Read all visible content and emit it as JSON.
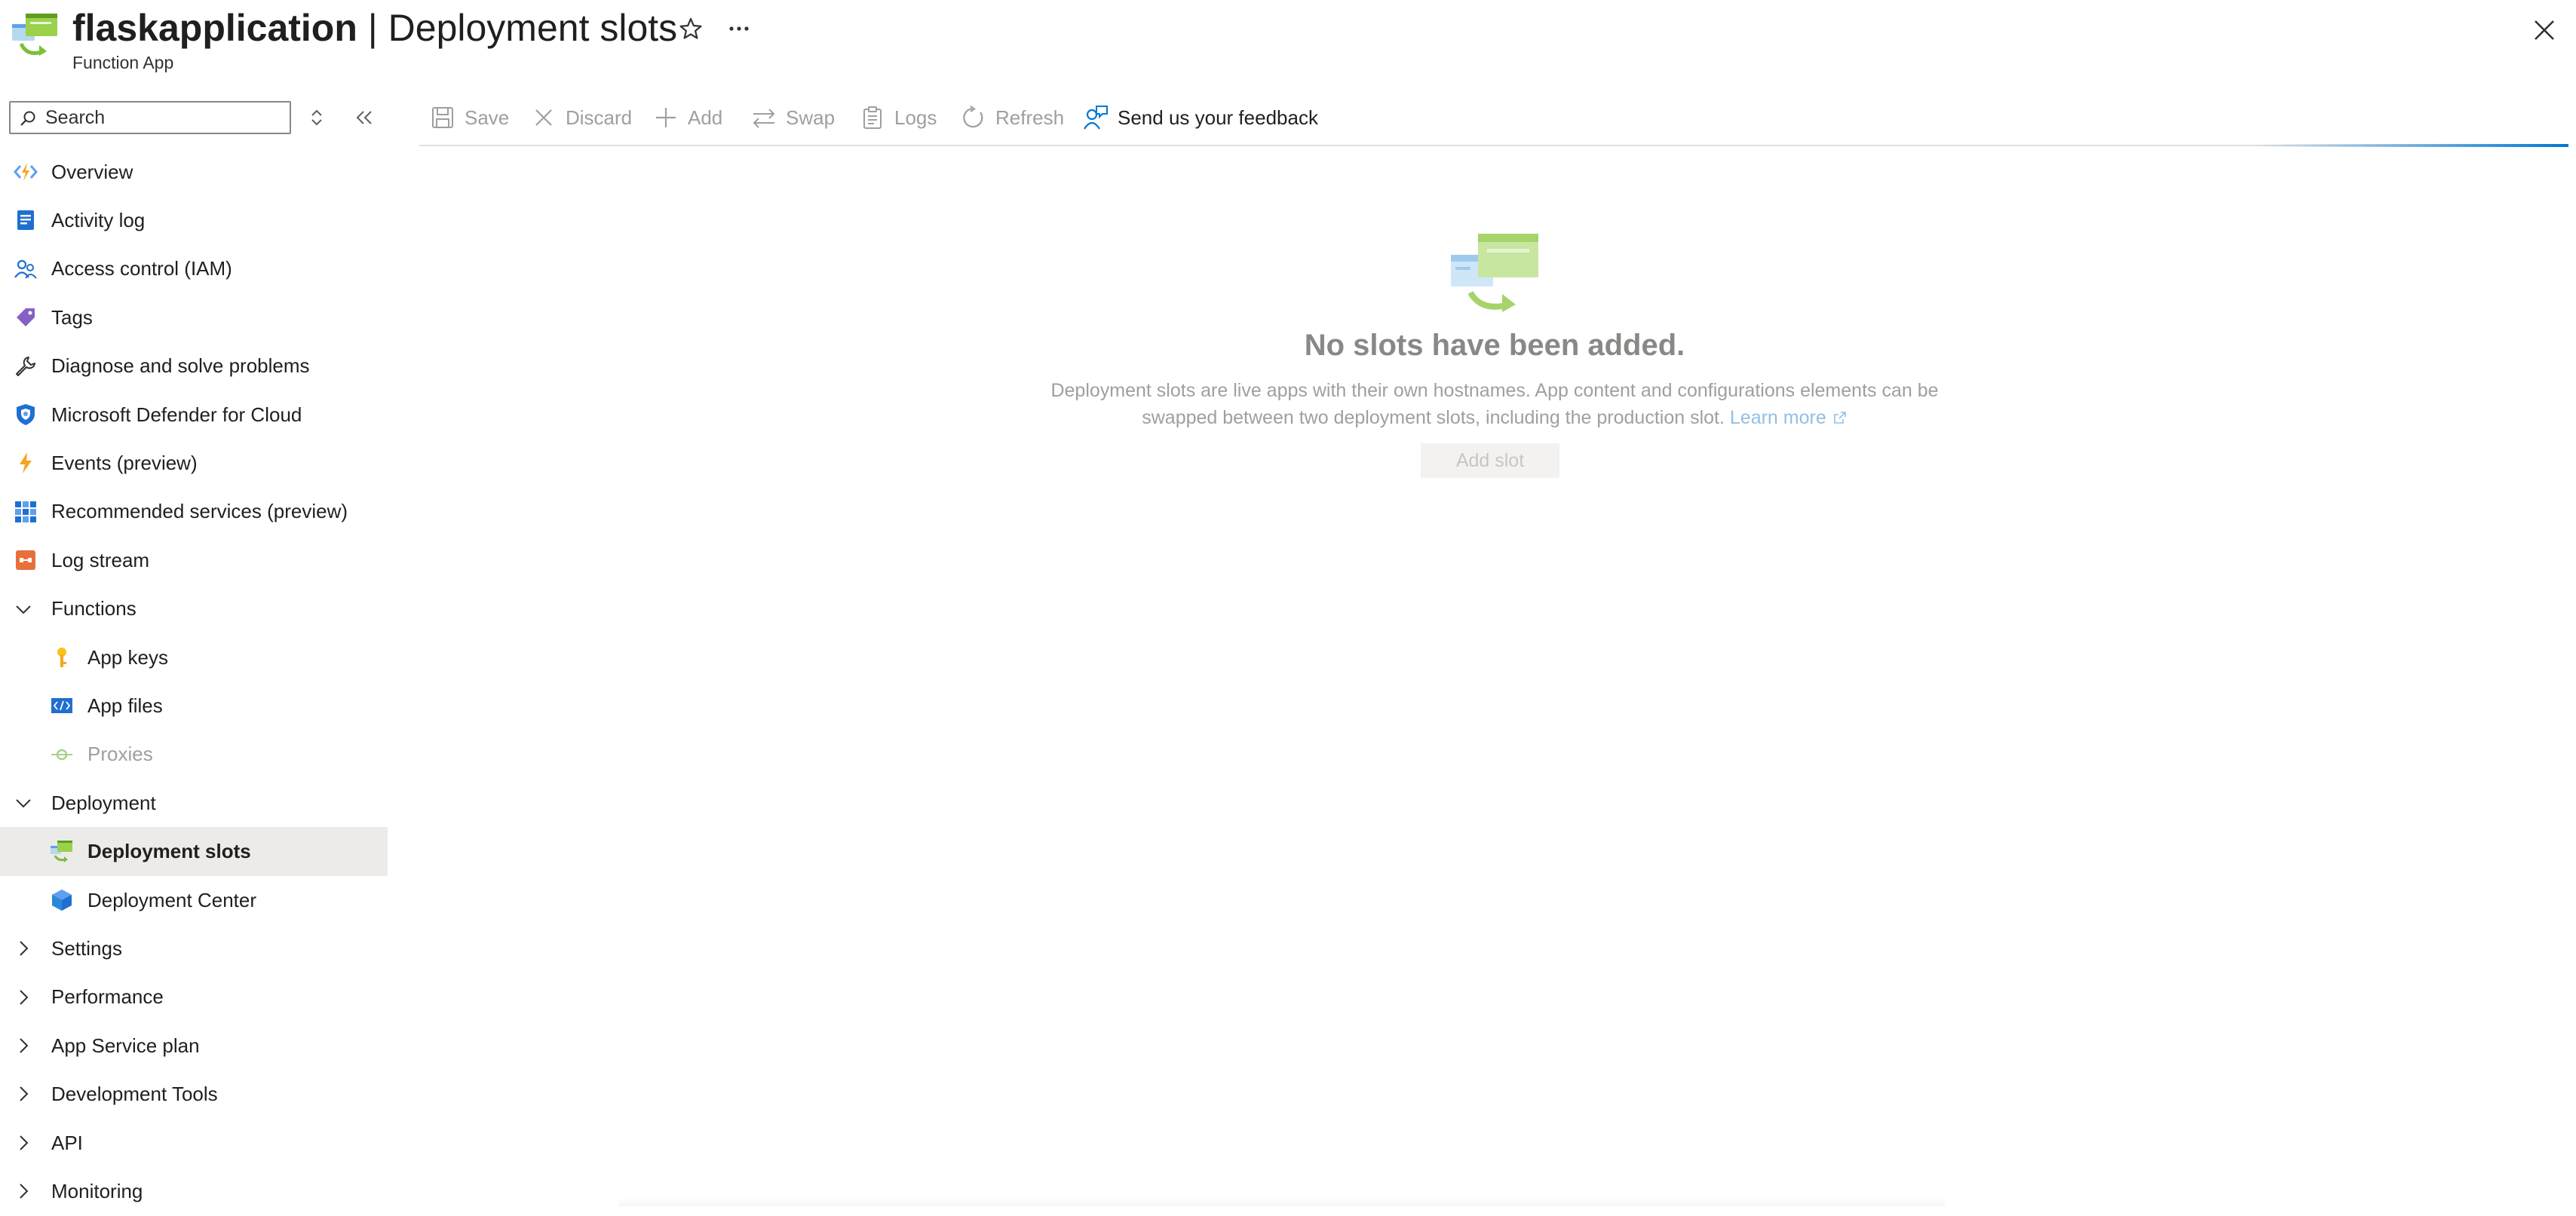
{
  "header": {
    "resource_name": "flaskapplication",
    "separator": " | ",
    "page_title": "Deployment slots",
    "subtitle": "Function App"
  },
  "sidebar": {
    "search_placeholder": "Search",
    "items": [
      {
        "label": "Overview",
        "icon": "function-app-icon"
      },
      {
        "label": "Activity log",
        "icon": "activity-log-icon"
      },
      {
        "label": "Access control (IAM)",
        "icon": "iam-people-icon"
      },
      {
        "label": "Tags",
        "icon": "tag-icon"
      },
      {
        "label": "Diagnose and solve problems",
        "icon": "wrench-icon"
      },
      {
        "label": "Microsoft Defender for Cloud",
        "icon": "shield-icon"
      },
      {
        "label": "Events (preview)",
        "icon": "lightning-icon"
      },
      {
        "label": "Recommended services (preview)",
        "icon": "grid-icon"
      },
      {
        "label": "Log stream",
        "icon": "log-stream-icon"
      },
      {
        "label": "Functions",
        "group": true,
        "expanded": true
      },
      {
        "label": "App keys",
        "icon": "key-icon",
        "child": true
      },
      {
        "label": "App files",
        "icon": "code-file-icon",
        "child": true
      },
      {
        "label": "Proxies",
        "icon": "proxy-icon",
        "child": true,
        "disabled": true
      },
      {
        "label": "Deployment",
        "group": true,
        "expanded": true
      },
      {
        "label": "Deployment slots",
        "icon": "deployment-slots-icon",
        "child": true,
        "selected": true
      },
      {
        "label": "Deployment Center",
        "icon": "cube-icon",
        "child": true
      },
      {
        "label": "Settings",
        "group": true,
        "expanded": false
      },
      {
        "label": "Performance",
        "group": true,
        "expanded": false
      },
      {
        "label": "App Service plan",
        "group": true,
        "expanded": false
      },
      {
        "label": "Development Tools",
        "group": true,
        "expanded": false
      },
      {
        "label": "API",
        "group": true,
        "expanded": false
      },
      {
        "label": "Monitoring",
        "group": true,
        "expanded": false
      }
    ]
  },
  "toolbar": {
    "save": "Save",
    "discard": "Discard",
    "add": "Add",
    "swap": "Swap",
    "logs": "Logs",
    "refresh": "Refresh",
    "feedback": "Send us your feedback"
  },
  "main": {
    "empty_title": "No slots have been added.",
    "empty_desc": "Deployment slots are live apps with their own hostnames. App content and configurations elements can be swapped between two deployment slots, including the production slot.",
    "learn_more": "Learn more",
    "add_slot": "Add slot"
  },
  "colors": {
    "accent": "#0078d4",
    "selected_bg": "#edebe9",
    "disabled_text": "#a19f9d"
  }
}
